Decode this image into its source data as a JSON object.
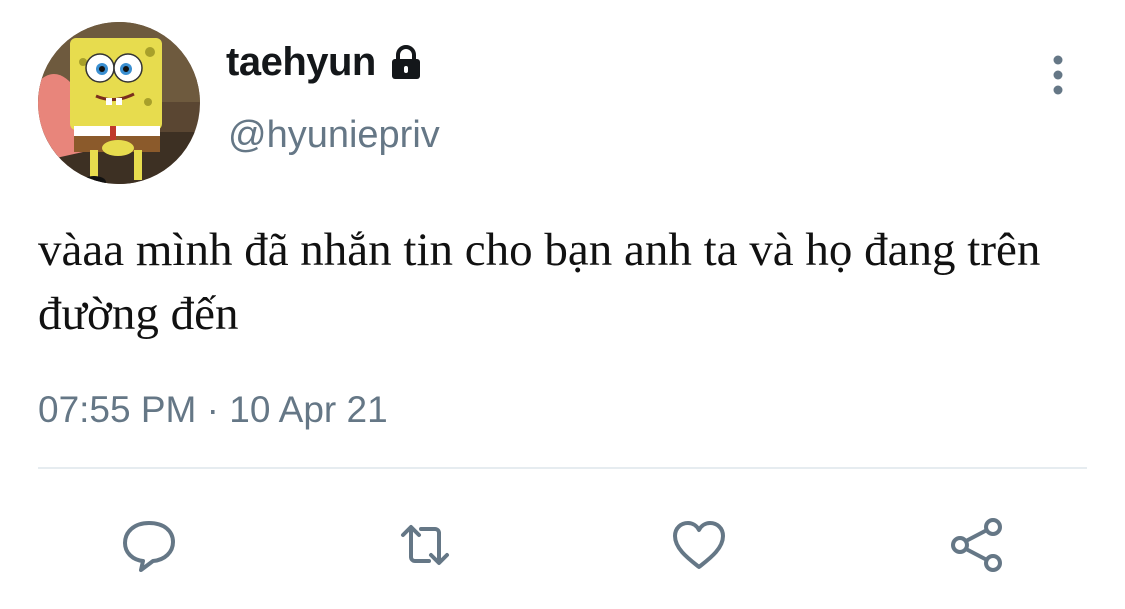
{
  "user": {
    "display_name": "taehyun",
    "handle": "@hyuniepriv",
    "avatar_icon": "spongebob-avatar",
    "protected_icon": "lock-icon"
  },
  "tweet": {
    "text": "vàaa mình đã nhắn tin cho bạn anh ta và họ đang trên đường đến",
    "timestamp": "07:55 PM · 10 Apr 21"
  },
  "actions": {
    "reply_icon": "reply-icon",
    "retweet_icon": "retweet-icon",
    "like_icon": "heart-icon",
    "share_icon": "share-icon",
    "more_icon": "more-vertical-icon"
  },
  "colors": {
    "secondary_text": "#657786",
    "primary_text": "#14171a",
    "divider": "#e6ecf0"
  }
}
